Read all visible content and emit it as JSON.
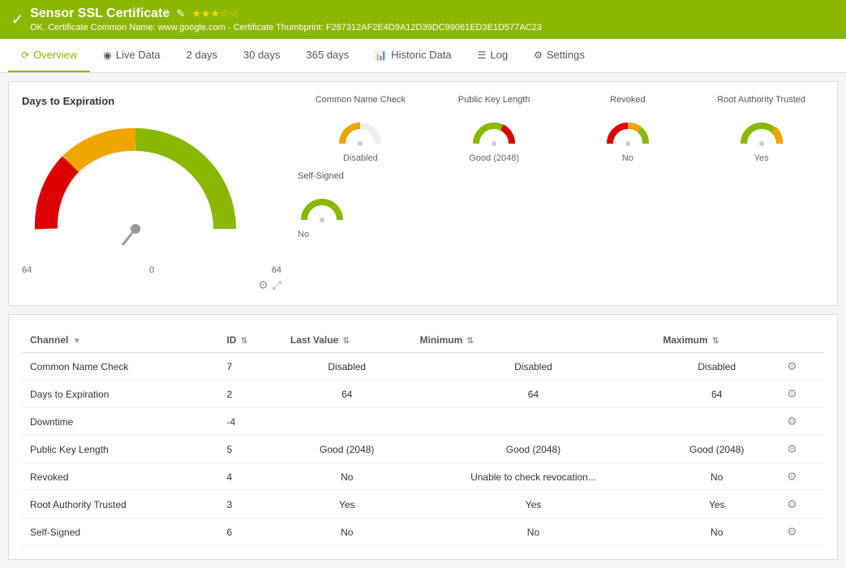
{
  "header": {
    "check_icon": "✓",
    "title": "Sensor SSL Certificate",
    "edit_icon": "✎",
    "stars": "★★★☆☆",
    "subtitle": "OK. Certificate Common Name: www.google.com - Certificate Thumbprint: F287312AF2E4D9A12D39DC99061ED3E1D577AC23"
  },
  "nav": {
    "tabs": [
      {
        "id": "overview",
        "icon": "⟳",
        "label": "Overview",
        "active": true
      },
      {
        "id": "live-data",
        "icon": "◉",
        "label": "Live Data",
        "active": false
      },
      {
        "id": "2days",
        "icon": "",
        "label": "2  days",
        "active": false
      },
      {
        "id": "30days",
        "icon": "",
        "label": "30  days",
        "active": false
      },
      {
        "id": "365days",
        "icon": "",
        "label": "365  days",
        "active": false
      },
      {
        "id": "historic-data",
        "icon": "📊",
        "label": "Historic Data",
        "active": false
      },
      {
        "id": "log",
        "icon": "☰",
        "label": "Log",
        "active": false
      },
      {
        "id": "settings",
        "icon": "⚙",
        "label": "Settings",
        "active": false
      }
    ]
  },
  "overview": {
    "gauge_title": "Days to Expiration",
    "gauge_min": "64",
    "gauge_zero": "0",
    "gauge_max": "64",
    "mini_gauges": [
      {
        "id": "common-name-check",
        "title": "Common Name Check",
        "value": "Disabled",
        "color": "#f0a500"
      },
      {
        "id": "public-key-length",
        "title": "Public Key Length",
        "value": "Good (2048)",
        "color": "#8ab800"
      },
      {
        "id": "revoked",
        "title": "Revoked",
        "value": "No",
        "color": "#dd0000"
      },
      {
        "id": "root-authority",
        "title": "Root Authority Trusted",
        "value": "Yes",
        "color": "#8ab800"
      }
    ],
    "self_signed": {
      "title": "Self-Signed",
      "value": "No",
      "color": "#8ab800"
    }
  },
  "table": {
    "columns": [
      {
        "id": "channel",
        "label": "Channel",
        "sortable": true
      },
      {
        "id": "id",
        "label": "ID",
        "sortable": true
      },
      {
        "id": "last-value",
        "label": "Last Value",
        "sortable": true
      },
      {
        "id": "minimum",
        "label": "Minimum",
        "sortable": true
      },
      {
        "id": "maximum",
        "label": "Maximum",
        "sortable": true
      },
      {
        "id": "actions",
        "label": "",
        "sortable": false
      }
    ],
    "rows": [
      {
        "channel": "Common Name Check",
        "id": "7",
        "last_value": "Disabled",
        "minimum": "Disabled",
        "maximum": "Disabled"
      },
      {
        "channel": "Days to Expiration",
        "id": "2",
        "last_value": "64",
        "minimum": "64",
        "maximum": "64"
      },
      {
        "channel": "Downtime",
        "id": "-4",
        "last_value": "",
        "minimum": "",
        "maximum": ""
      },
      {
        "channel": "Public Key Length",
        "id": "5",
        "last_value": "Good (2048)",
        "minimum": "Good (2048)",
        "maximum": "Good (2048)"
      },
      {
        "channel": "Revoked",
        "id": "4",
        "last_value": "No",
        "minimum": "Unable to check revocation...",
        "maximum": "No"
      },
      {
        "channel": "Root Authority Trusted",
        "id": "3",
        "last_value": "Yes",
        "minimum": "Yes",
        "maximum": "Yes"
      },
      {
        "channel": "Self-Signed",
        "id": "6",
        "last_value": "No",
        "minimum": "No",
        "maximum": "No"
      }
    ]
  }
}
